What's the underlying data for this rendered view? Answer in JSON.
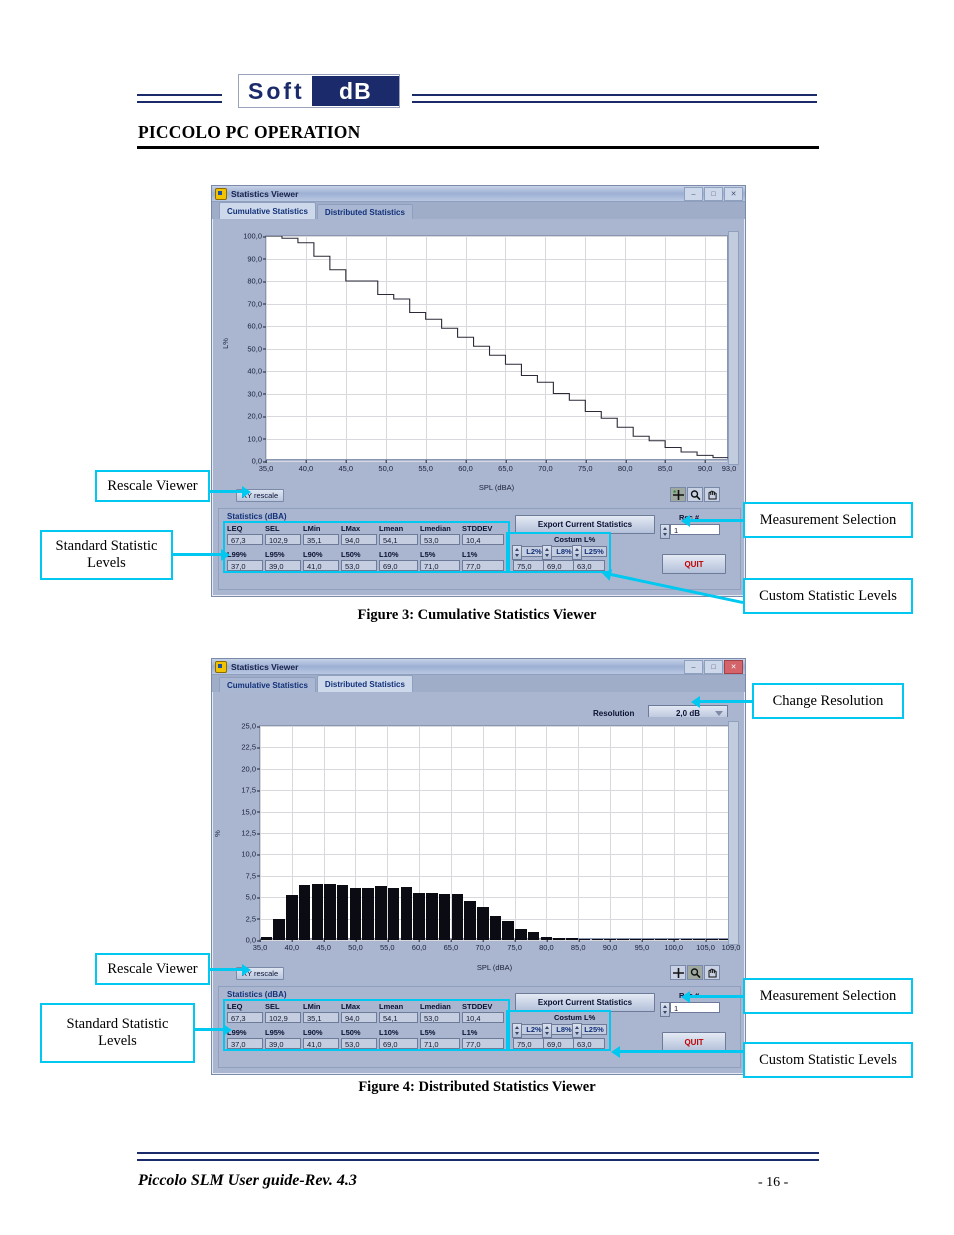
{
  "document": {
    "brand_soft": "Soft",
    "brand_db": "dB",
    "chapter_title": "PICCOLO PC OPERATION",
    "footer_left": "Piccolo SLM User guide-Rev. 4.3",
    "footer_page": "- 16 -",
    "caption_fig3": "Figure 3: Cumulative Statistics Viewer",
    "caption_fig4": "Figure 4: Distributed Statistics Viewer"
  },
  "callouts": {
    "rescale_viewer": "Rescale Viewer",
    "standard_statistic_levels": "Standard Statistic\nLevels",
    "measurement_selection": "Measurement Selection",
    "custom_statistic_levels": "Custom Statistic Levels",
    "change_resolution": "Change Resolution"
  },
  "window": {
    "title": "Statistics Viewer",
    "minimize": "–",
    "maximize": "□",
    "close": "✕",
    "tabs": [
      {
        "label": "Cumulative Statistics"
      },
      {
        "label": "Distributed Statistics"
      }
    ]
  },
  "viewer_controls": {
    "rescale_label": "XY rescale",
    "export_label": "Export Current Statistics",
    "quit_label": "QUIT",
    "rec_label": "Rec #",
    "rec_value": "1",
    "custom_group_label": "Costum L%",
    "resolution_label": "Resolution",
    "resolution_value": "2,0 dB",
    "tool_icons": [
      "crosshair-cursor-icon",
      "zoom-magnifier-icon",
      "pan-hand-icon"
    ]
  },
  "statistics": {
    "panel_title": "Statistics (dBA)",
    "row1_headers": [
      "LEQ",
      "SEL",
      "LMin",
      "LMax",
      "Lmean",
      "Lmedian",
      "STDDEV"
    ],
    "row1_values": [
      "67,3",
      "102,9",
      "35,1",
      "94,0",
      "54,1",
      "53,0",
      "10,4"
    ],
    "row2_headers": [
      "L99%",
      "L95%",
      "L90%",
      "L50%",
      "L10%",
      "L5%",
      "L1%"
    ],
    "row2_values": [
      "37,0",
      "39,0",
      "41,0",
      "53,0",
      "69,0",
      "71,0",
      "77,0"
    ],
    "custom_headers": [
      "L2%",
      "L8%",
      "L25%"
    ],
    "custom_values": [
      "75,0",
      "69,0",
      "63,0"
    ]
  },
  "chart_data": [
    {
      "id": "cumulative",
      "type": "line",
      "title": "Cumulative Statistics Viewer",
      "xlabel": "SPL (dBA)",
      "ylabel": "L%",
      "xlim": [
        35.0,
        93.0
      ],
      "ylim": [
        0.0,
        100.0
      ],
      "xticks": [
        35.0,
        40.0,
        45.0,
        50.0,
        55.0,
        60.0,
        65.0,
        70.0,
        75.0,
        80.0,
        85.0,
        90.0,
        93.0
      ],
      "xticklabels": [
        "35,0",
        "40,0",
        "45,0",
        "50,0",
        "55,0",
        "60,0",
        "65,0",
        "70,0",
        "75,0",
        "80,0",
        "85,0",
        "90,0",
        "93,0"
      ],
      "yticks": [
        0.0,
        10.0,
        20.0,
        30.0,
        40.0,
        50.0,
        60.0,
        70.0,
        80.0,
        90.0,
        100.0
      ],
      "yticklabels": [
        "0,0",
        "10,0",
        "20,0",
        "30,0",
        "40,0",
        "50,0",
        "60,0",
        "70,0",
        "80,0",
        "90,0",
        "100,0"
      ],
      "grid": true,
      "legend": "none",
      "step_style": "post",
      "x": [
        35,
        37,
        39,
        41,
        43,
        45,
        47,
        49,
        51,
        53,
        55,
        57,
        59,
        61,
        63,
        65,
        67,
        69,
        71,
        73,
        75,
        77,
        79,
        81,
        83,
        85,
        87,
        89,
        91,
        93
      ],
      "y": [
        100,
        99,
        97,
        91,
        85,
        80,
        80,
        74,
        72,
        66,
        63,
        59,
        55,
        51,
        47,
        43,
        38,
        35,
        30,
        27,
        22,
        19,
        15,
        11,
        9,
        6,
        4,
        2.5,
        1.5,
        1.0,
        0.6,
        0.4,
        0.3
      ]
    },
    {
      "id": "distributed",
      "type": "bar",
      "title": "Distributed Statistics Viewer",
      "xlabel": "SPL (dBA)",
      "ylabel": "%",
      "xlim": [
        35.0,
        109.0
      ],
      "ylim": [
        0.0,
        25.0
      ],
      "xticks": [
        35.0,
        40.0,
        45.0,
        50.0,
        55.0,
        60.0,
        65.0,
        70.0,
        75.0,
        80.0,
        85.0,
        90.0,
        95.0,
        100.0,
        105.0,
        109.0
      ],
      "xticklabels": [
        "35,0",
        "40,0",
        "45,0",
        "50,0",
        "55,0",
        "60,0",
        "65,0",
        "70,0",
        "75,0",
        "80,0",
        "85,0",
        "90,0",
        "95,0",
        "100,0",
        "105,0",
        "109,0"
      ],
      "yticks": [
        0.0,
        2.5,
        5.0,
        7.5,
        10.0,
        12.5,
        15.0,
        17.5,
        20.0,
        22.5,
        25.0
      ],
      "yticklabels": [
        "0,0",
        "2,5",
        "5,0",
        "7,5",
        "10,0",
        "12,5",
        "15,0",
        "17,5",
        "20,0",
        "22,5",
        "25,0"
      ],
      "grid": true,
      "legend": "none",
      "bar_width_db": 2.0,
      "categories": [
        35,
        37,
        39,
        41,
        43,
        45,
        47,
        49,
        51,
        53,
        55,
        57,
        59,
        61,
        63,
        65,
        67,
        69,
        71,
        73,
        75,
        77,
        79,
        81,
        83,
        85,
        87,
        89,
        91,
        93,
        95,
        97,
        99,
        101,
        103,
        105,
        107
      ],
      "values": [
        0.35,
        2.5,
        5.2,
        6.4,
        6.5,
        6.5,
        6.4,
        6.1,
        6.1,
        6.3,
        6.1,
        6.2,
        5.5,
        5.5,
        5.4,
        5.4,
        4.6,
        3.8,
        2.8,
        2.2,
        1.3,
        0.9,
        0.35,
        0.25,
        0.2,
        0.15,
        0.12,
        0.1,
        0.08,
        0.06,
        0.05,
        0.05,
        0.04,
        0.04,
        0.03,
        0.03,
        0.03
      ]
    }
  ]
}
